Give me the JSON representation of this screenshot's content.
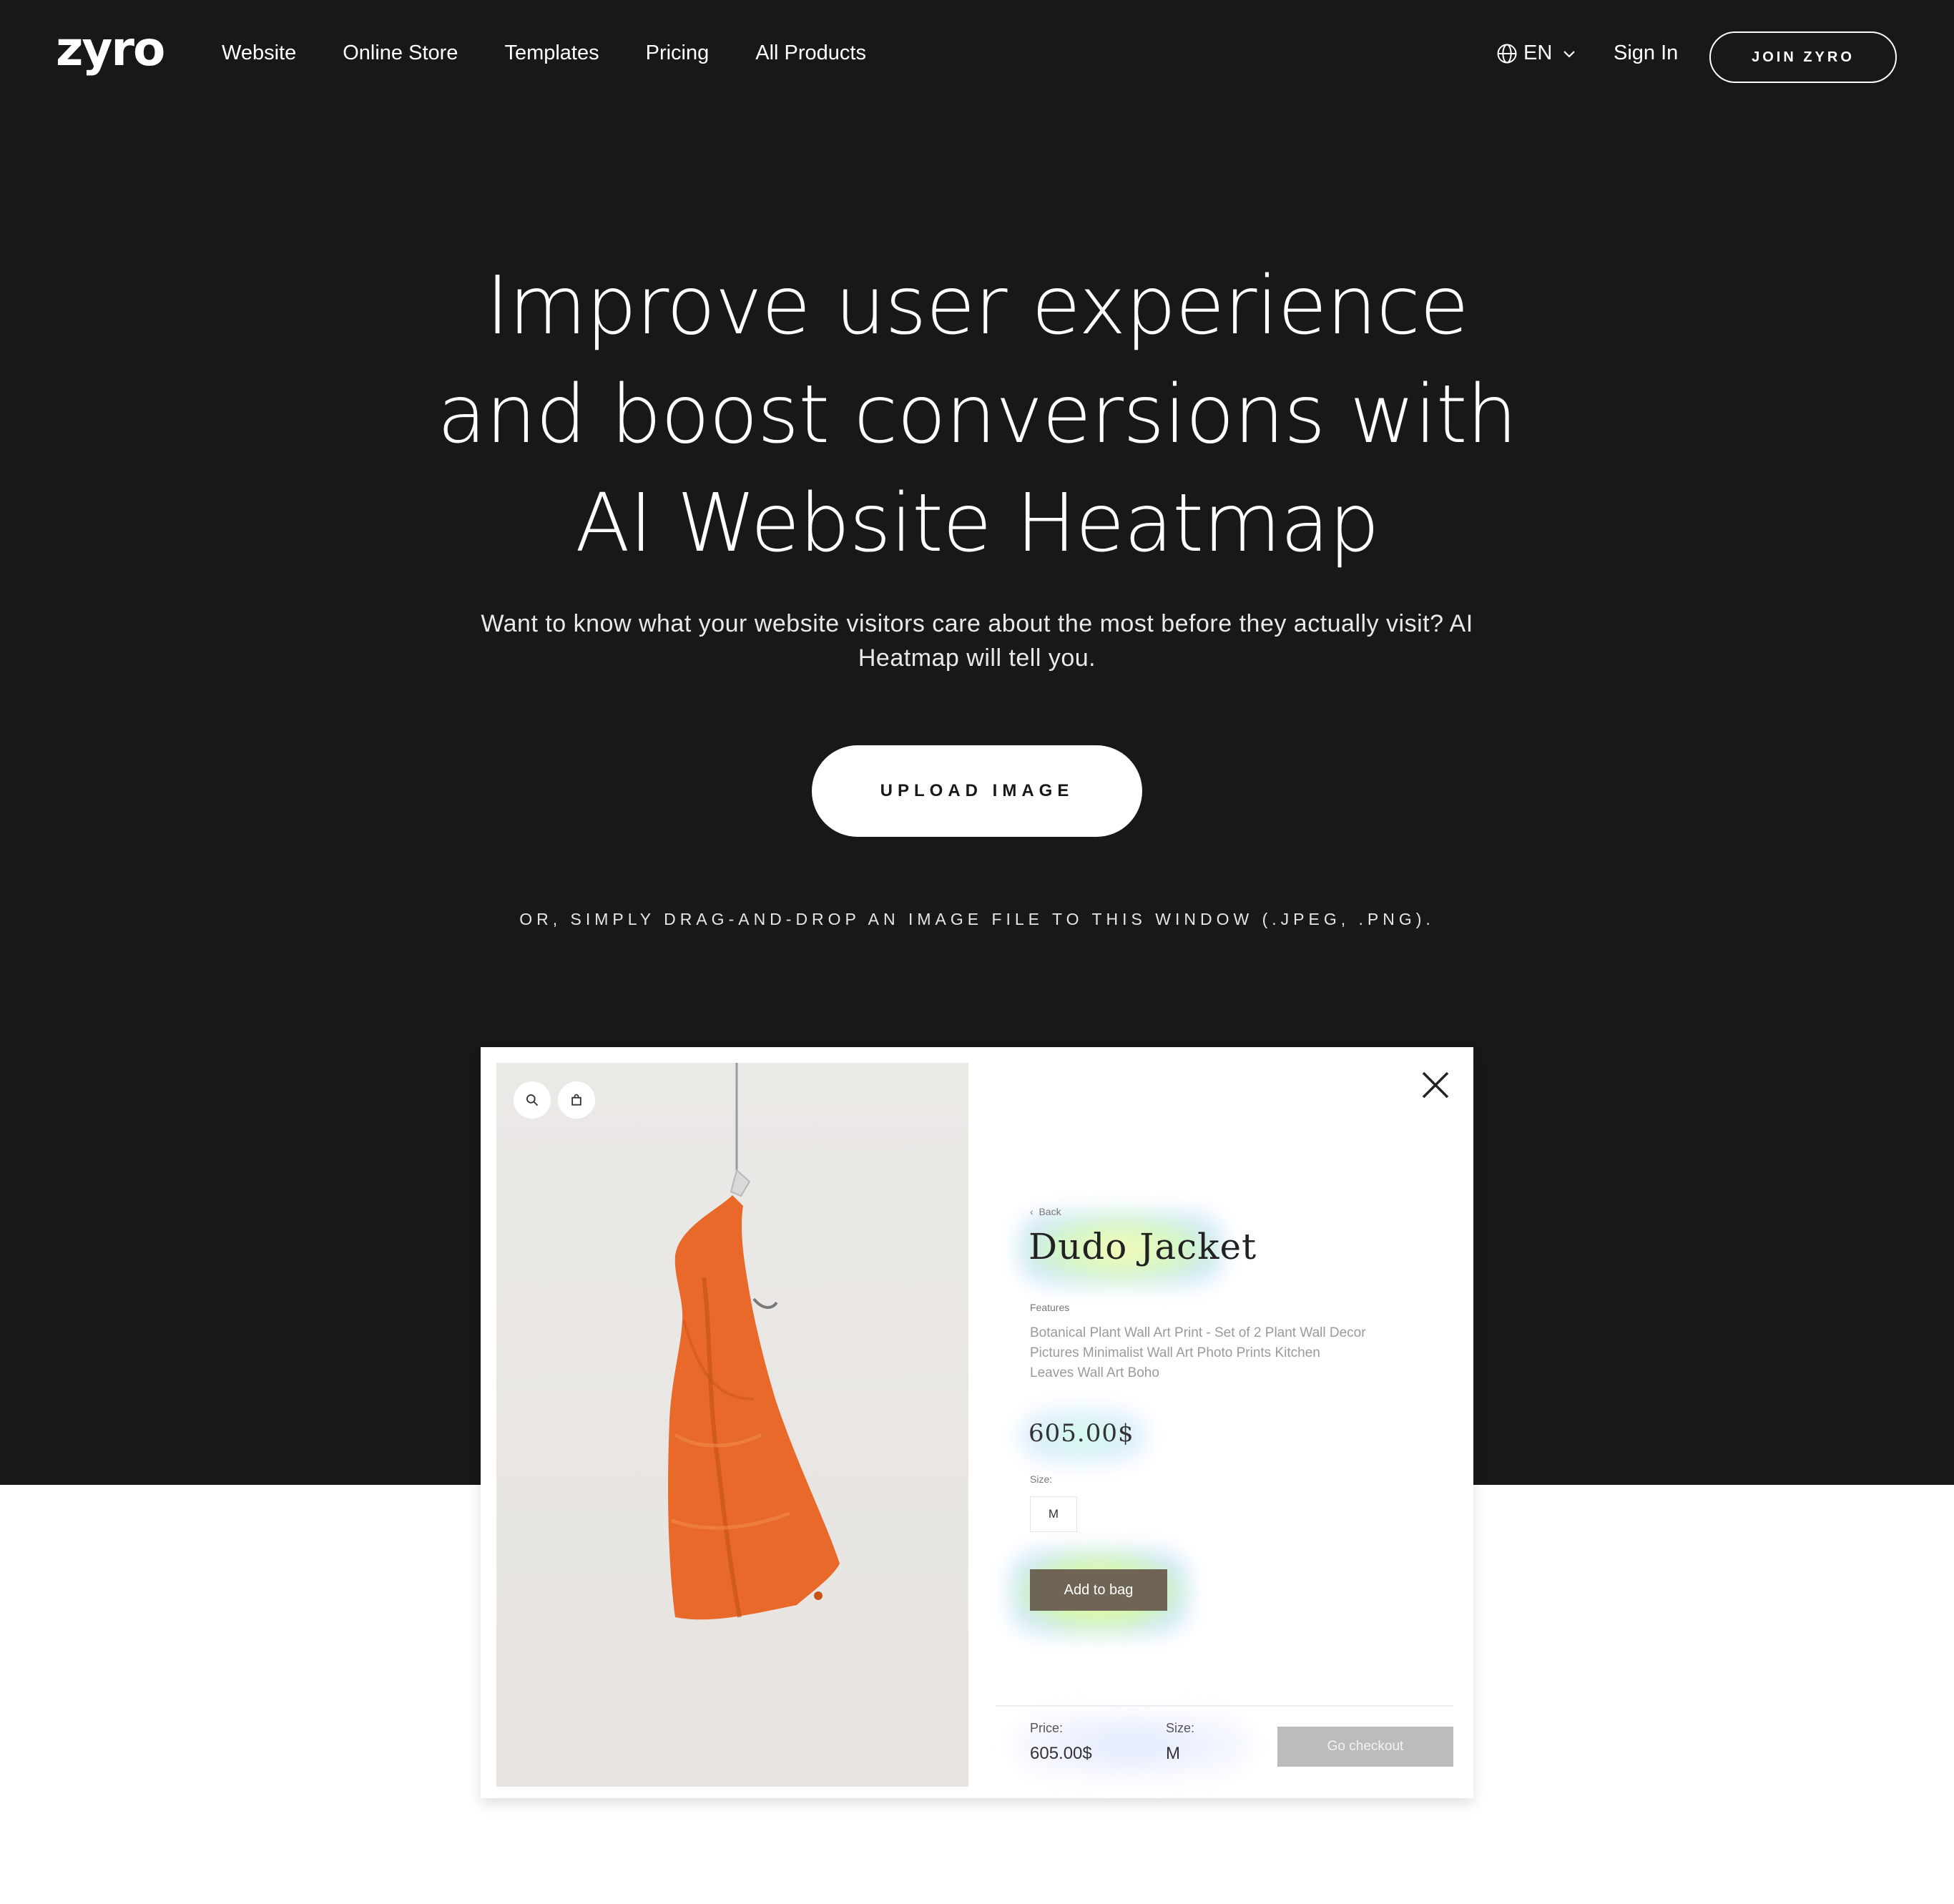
{
  "nav": {
    "logo": "zyro",
    "links": [
      "Website",
      "Online Store",
      "Templates",
      "Pricing",
      "All Products"
    ],
    "language": "EN",
    "sign_in": "Sign In",
    "join": "JOIN ZYRO"
  },
  "hero": {
    "title_lines": [
      "Improve user experience",
      "and boost conversions with",
      "AI Website Heatmap"
    ],
    "subtitle": "Want to know what your website visitors care about the most before they actually visit? AI Heatmap will tell you.",
    "upload_button": "UPLOAD IMAGE",
    "drag_hint": "OR, SIMPLY DRAG-AND-DROP AN IMAGE FILE TO THIS WINDOW (.JPEG, .PNG)."
  },
  "preview": {
    "back": "Back",
    "product_title": "Dudo Jacket",
    "features_label": "Features",
    "features_text": "Botanical Plant Wall Art Print - Set of 2 Plant Wall Decor Pictures Minimalist Wall Art Photo Prints Kitchen Leaves Wall Art Boho",
    "price": "605.00$",
    "size_label": "Size:",
    "size_value": "M",
    "add_to_bag": "Add to bag",
    "footer": {
      "price_label": "Price:",
      "price_value": "605.00$",
      "size_label": "Size:",
      "size_value": "M",
      "checkout": "Go checkout"
    }
  },
  "colors": {
    "hero_background": "#17181a",
    "add_to_bag": "#6e6555",
    "checkout": "#bcbcbc",
    "jacket": "#e8692a"
  },
  "icons": [
    "globe-icon",
    "chevron-down-icon",
    "search-icon",
    "bag-icon",
    "close-icon",
    "back-chevron-icon"
  ]
}
